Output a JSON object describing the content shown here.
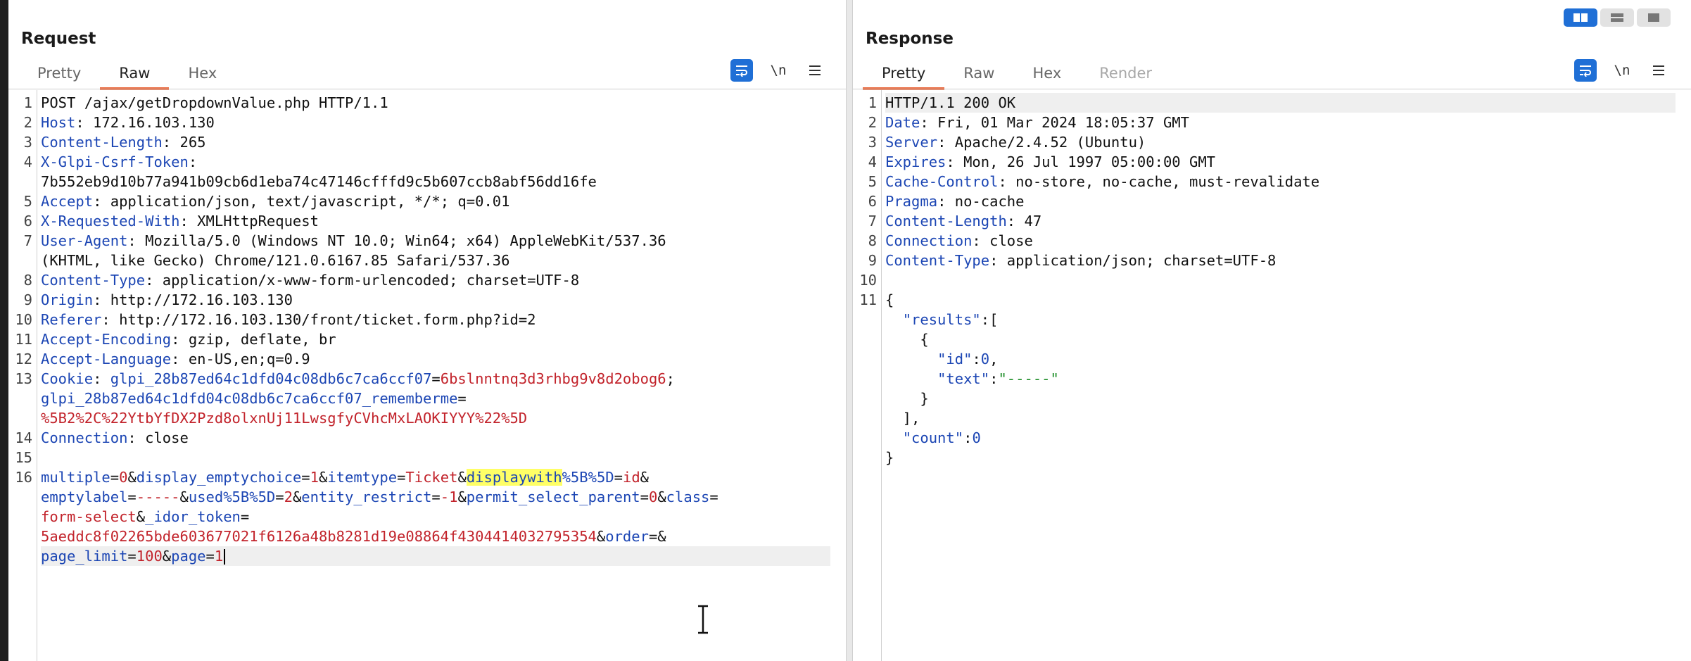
{
  "request": {
    "title": "Request",
    "tabs": [
      "Pretty",
      "Raw",
      "Hex"
    ],
    "active_tab": "Raw",
    "tool_newline": "\\n",
    "lines": [
      {
        "n": "1",
        "row": 0,
        "parts": [
          {
            "t": "POST /ajax/getDropdownValue.php HTTP/1.1",
            "c": ""
          }
        ]
      },
      {
        "n": "2",
        "row": 1,
        "parts": [
          {
            "t": "Host",
            "c": "key"
          },
          {
            "t": ": 172.16.103.130",
            "c": ""
          }
        ]
      },
      {
        "n": "3",
        "row": 2,
        "parts": [
          {
            "t": "Content-Length",
            "c": "key"
          },
          {
            "t": ": 265",
            "c": ""
          }
        ]
      },
      {
        "n": "4",
        "row": 3,
        "parts": [
          {
            "t": "X-Glpi-Csrf-Token",
            "c": "key"
          },
          {
            "t": ":",
            "c": ""
          }
        ]
      },
      {
        "n": "",
        "row": 4,
        "parts": [
          {
            "t": "7b552eb9d10b77a941b09cb6d1eba74c47146cfffd9c5b607ccb8abf56dd16fe",
            "c": ""
          }
        ]
      },
      {
        "n": "5",
        "row": 5,
        "parts": [
          {
            "t": "Accept",
            "c": "key"
          },
          {
            "t": ": application/json, text/javascript, */*; q=0.01",
            "c": ""
          }
        ]
      },
      {
        "n": "6",
        "row": 6,
        "parts": [
          {
            "t": "X-Requested-With",
            "c": "key"
          },
          {
            "t": ": XMLHttpRequest",
            "c": ""
          }
        ]
      },
      {
        "n": "7",
        "row": 7,
        "parts": [
          {
            "t": "User-Agent",
            "c": "key"
          },
          {
            "t": ": Mozilla/5.0 (Windows NT 10.0; Win64; x64) AppleWebKit/537.36",
            "c": ""
          }
        ]
      },
      {
        "n": "",
        "row": 8,
        "parts": [
          {
            "t": "(KHTML, like Gecko) Chrome/121.0.6167.85 Safari/537.36",
            "c": ""
          }
        ]
      },
      {
        "n": "8",
        "row": 9,
        "parts": [
          {
            "t": "Content-Type",
            "c": "key"
          },
          {
            "t": ": application/x-www-form-urlencoded; charset=UTF-8",
            "c": ""
          }
        ]
      },
      {
        "n": "9",
        "row": 10,
        "parts": [
          {
            "t": "Origin",
            "c": "key"
          },
          {
            "t": ": http://172.16.103.130",
            "c": ""
          }
        ]
      },
      {
        "n": "10",
        "row": 11,
        "parts": [
          {
            "t": "Referer",
            "c": "key"
          },
          {
            "t": ": http://172.16.103.130/front/ticket.form.php?id=2",
            "c": ""
          }
        ]
      },
      {
        "n": "11",
        "row": 12,
        "parts": [
          {
            "t": "Accept-Encoding",
            "c": "key"
          },
          {
            "t": ": gzip, deflate, br",
            "c": ""
          }
        ]
      },
      {
        "n": "12",
        "row": 13,
        "parts": [
          {
            "t": "Accept-Language",
            "c": "key"
          },
          {
            "t": ": en-US,en;q=0.9",
            "c": ""
          }
        ]
      },
      {
        "n": "13",
        "row": 14,
        "parts": [
          {
            "t": "Cookie",
            "c": "key"
          },
          {
            "t": ": ",
            "c": ""
          },
          {
            "t": "glpi_28b87ed64c1dfd04c08db6c7ca6ccf07",
            "c": "key"
          },
          {
            "t": "=",
            "c": ""
          },
          {
            "t": "6bslnntnq3d3rhbg9v8d2obog6",
            "c": "val"
          },
          {
            "t": ";",
            "c": ""
          }
        ]
      },
      {
        "n": "",
        "row": 15,
        "parts": [
          {
            "t": "glpi_28b87ed64c1dfd04c08db6c7ca6ccf07_rememberme",
            "c": "key"
          },
          {
            "t": "=",
            "c": ""
          }
        ]
      },
      {
        "n": "",
        "row": 16,
        "parts": [
          {
            "t": "%5B2%2C%22YtbYfDX2Pzd8olxnUj11LwsgfyCVhcMxLAOKIYYY%22%5D",
            "c": "val"
          }
        ]
      },
      {
        "n": "14",
        "row": 17,
        "parts": [
          {
            "t": "Connection",
            "c": "key"
          },
          {
            "t": ": close",
            "c": ""
          }
        ]
      },
      {
        "n": "15",
        "row": 18,
        "parts": [
          {
            "t": "",
            "c": ""
          }
        ]
      },
      {
        "n": "16",
        "row": 19,
        "parts": [
          {
            "t": "multiple",
            "c": "key"
          },
          {
            "t": "=",
            "c": ""
          },
          {
            "t": "0",
            "c": "val"
          },
          {
            "t": "&",
            "c": ""
          },
          {
            "t": "display_emptychoice",
            "c": "key"
          },
          {
            "t": "=",
            "c": ""
          },
          {
            "t": "1",
            "c": "val"
          },
          {
            "t": "&",
            "c": ""
          },
          {
            "t": "itemtype",
            "c": "key"
          },
          {
            "t": "=",
            "c": ""
          },
          {
            "t": "Ticket",
            "c": "val"
          },
          {
            "t": "&",
            "c": ""
          },
          {
            "t": "displaywith",
            "c": "hl"
          },
          {
            "t": "%5B%5D",
            "c": "key"
          },
          {
            "t": "=",
            "c": ""
          },
          {
            "t": "id",
            "c": "val"
          },
          {
            "t": "&",
            "c": ""
          }
        ]
      },
      {
        "n": "",
        "row": 20,
        "parts": [
          {
            "t": "emptylabel",
            "c": "key"
          },
          {
            "t": "=",
            "c": ""
          },
          {
            "t": "-----",
            "c": "val"
          },
          {
            "t": "&",
            "c": ""
          },
          {
            "t": "used%5B%5D",
            "c": "key"
          },
          {
            "t": "=",
            "c": ""
          },
          {
            "t": "2",
            "c": "val"
          },
          {
            "t": "&",
            "c": ""
          },
          {
            "t": "entity_restrict",
            "c": "key"
          },
          {
            "t": "=",
            "c": ""
          },
          {
            "t": "-1",
            "c": "val"
          },
          {
            "t": "&",
            "c": ""
          },
          {
            "t": "permit_select_parent",
            "c": "key"
          },
          {
            "t": "=",
            "c": ""
          },
          {
            "t": "0",
            "c": "val"
          },
          {
            "t": "&",
            "c": ""
          },
          {
            "t": "class",
            "c": "key"
          },
          {
            "t": "=",
            "c": ""
          }
        ]
      },
      {
        "n": "",
        "row": 21,
        "parts": [
          {
            "t": "form-select",
            "c": "val"
          },
          {
            "t": "&",
            "c": ""
          },
          {
            "t": "_idor_token",
            "c": "key"
          },
          {
            "t": "=",
            "c": ""
          }
        ]
      },
      {
        "n": "",
        "row": 22,
        "parts": [
          {
            "t": "5aeddc8f02265bde603677021f6126a48b8281d19e08864f4304414032795354",
            "c": "val"
          },
          {
            "t": "&",
            "c": ""
          },
          {
            "t": "order",
            "c": "key"
          },
          {
            "t": "=&",
            "c": ""
          }
        ]
      },
      {
        "n": "",
        "row": 23,
        "parts": [
          {
            "t": "page_limit",
            "c": "key"
          },
          {
            "t": "=",
            "c": ""
          },
          {
            "t": "100",
            "c": "val"
          },
          {
            "t": "&",
            "c": ""
          },
          {
            "t": "page",
            "c": "key"
          },
          {
            "t": "=",
            "c": ""
          },
          {
            "t": "1",
            "c": "val"
          }
        ],
        "current": true
      }
    ]
  },
  "response": {
    "title": "Response",
    "tabs": [
      "Pretty",
      "Raw",
      "Hex",
      "Render"
    ],
    "active_tab": "Pretty",
    "disabled_tab": "Render",
    "tool_newline": "\\n",
    "lines": [
      {
        "n": "1",
        "row": 0,
        "parts": [
          {
            "t": "HTTP/1.1 200 OK",
            "c": ""
          }
        ],
        "current": true
      },
      {
        "n": "2",
        "row": 1,
        "parts": [
          {
            "t": "Date",
            "c": "key"
          },
          {
            "t": ": Fri, 01 Mar 2024 18:05:37 GMT",
            "c": ""
          }
        ]
      },
      {
        "n": "3",
        "row": 2,
        "parts": [
          {
            "t": "Server",
            "c": "key"
          },
          {
            "t": ": Apache/2.4.52 (Ubuntu)",
            "c": ""
          }
        ]
      },
      {
        "n": "4",
        "row": 3,
        "parts": [
          {
            "t": "Expires",
            "c": "key"
          },
          {
            "t": ": Mon, 26 Jul 1997 05:00:00 GMT",
            "c": ""
          }
        ]
      },
      {
        "n": "5",
        "row": 4,
        "parts": [
          {
            "t": "Cache-Control",
            "c": "key"
          },
          {
            "t": ": no-store, no-cache, must-revalidate",
            "c": ""
          }
        ]
      },
      {
        "n": "6",
        "row": 5,
        "parts": [
          {
            "t": "Pragma",
            "c": "key"
          },
          {
            "t": ": no-cache",
            "c": ""
          }
        ]
      },
      {
        "n": "7",
        "row": 6,
        "parts": [
          {
            "t": "Content-Length",
            "c": "key"
          },
          {
            "t": ": 47",
            "c": ""
          }
        ]
      },
      {
        "n": "8",
        "row": 7,
        "parts": [
          {
            "t": "Connection",
            "c": "key"
          },
          {
            "t": ": close",
            "c": ""
          }
        ]
      },
      {
        "n": "9",
        "row": 8,
        "parts": [
          {
            "t": "Content-Type",
            "c": "key"
          },
          {
            "t": ": application/json; charset=UTF-8",
            "c": ""
          }
        ]
      },
      {
        "n": "10",
        "row": 9,
        "parts": [
          {
            "t": "",
            "c": ""
          }
        ]
      },
      {
        "n": "11",
        "row": 10,
        "parts": [
          {
            "t": "{",
            "c": ""
          }
        ]
      },
      {
        "n": "",
        "row": 11,
        "parts": [
          {
            "t": "  ",
            "c": ""
          },
          {
            "t": "\"results\"",
            "c": "key"
          },
          {
            "t": ":[",
            "c": ""
          }
        ]
      },
      {
        "n": "",
        "row": 12,
        "parts": [
          {
            "t": "    {",
            "c": ""
          }
        ]
      },
      {
        "n": "",
        "row": 13,
        "parts": [
          {
            "t": "      ",
            "c": ""
          },
          {
            "t": "\"id\"",
            "c": "key"
          },
          {
            "t": ":",
            "c": ""
          },
          {
            "t": "0",
            "c": "num"
          },
          {
            "t": ",",
            "c": ""
          }
        ]
      },
      {
        "n": "",
        "row": 14,
        "parts": [
          {
            "t": "      ",
            "c": ""
          },
          {
            "t": "\"text\"",
            "c": "key"
          },
          {
            "t": ":",
            "c": ""
          },
          {
            "t": "\"-----\"",
            "c": "str"
          }
        ]
      },
      {
        "n": "",
        "row": 15,
        "parts": [
          {
            "t": "    }",
            "c": ""
          }
        ]
      },
      {
        "n": "",
        "row": 16,
        "parts": [
          {
            "t": "  ],",
            "c": ""
          }
        ]
      },
      {
        "n": "",
        "row": 17,
        "parts": [
          {
            "t": "  ",
            "c": ""
          },
          {
            "t": "\"count\"",
            "c": "key"
          },
          {
            "t": ":",
            "c": ""
          },
          {
            "t": "0",
            "c": "num"
          }
        ]
      },
      {
        "n": "",
        "row": 18,
        "parts": [
          {
            "t": "}",
            "c": ""
          }
        ]
      }
    ]
  },
  "colors": {
    "accent": "#e8663b",
    "toggle_blue": "#1f6fd6",
    "header_key": "#1c46b4",
    "param_value": "#c2232b",
    "string": "#1f8f2a",
    "search_highlight": "#ffff66"
  },
  "icons": {
    "wrap": "wrap-lines-icon",
    "newline": "show-newlines-icon",
    "menu": "hamburger-menu-icon",
    "cursor": "text-cursor-icon",
    "layout": [
      "split-horizontal-icon",
      "split-vertical-icon",
      "single-pane-icon"
    ]
  }
}
